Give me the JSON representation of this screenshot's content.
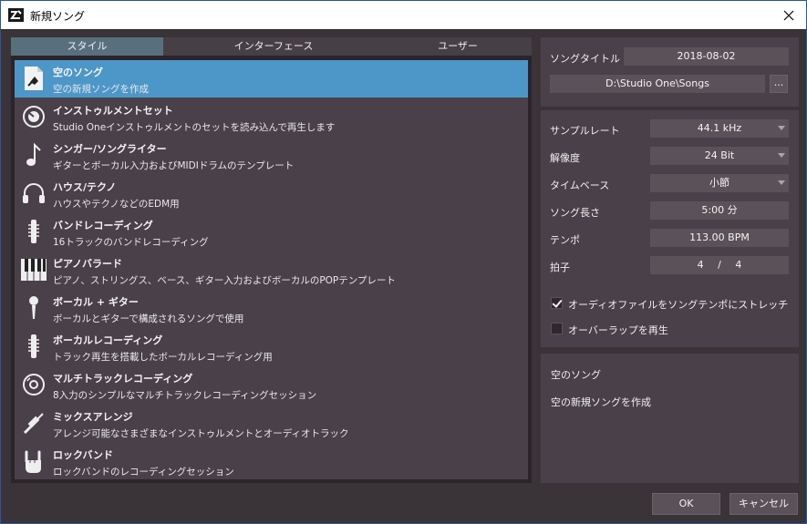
{
  "window": {
    "title": "新規ソング"
  },
  "tabs": [
    {
      "label": "スタイル",
      "active": true
    },
    {
      "label": "インターフェース",
      "active": false
    },
    {
      "label": "ユーザー",
      "active": false
    }
  ],
  "templates": [
    {
      "name": "空のソング",
      "desc": "空の新規ソングを作成",
      "icon": "blank-song-icon",
      "selected": true
    },
    {
      "name": "インストゥルメントセット",
      "desc": "Studio Oneインストゥルメントのセットを読み込んで再生します",
      "icon": "dial-icon",
      "selected": false
    },
    {
      "name": "シンガー/ソングライター",
      "desc": "ギターとボーカル入力およびMIDIドラムのテンプレート",
      "icon": "music-note-icon",
      "selected": false
    },
    {
      "name": "ハウス/テクノ",
      "desc": "ハウスやテクノなどのEDM用",
      "icon": "headphones-icon",
      "selected": false
    },
    {
      "name": "バンドレコーディング",
      "desc": "16トラックのバンドレコーディング",
      "icon": "mixer-icon",
      "selected": false
    },
    {
      "name": "ピアノバラード",
      "desc": "ピアノ、ストリングス、ベース、ギター入力およびボーカルのPOPテンプレート",
      "icon": "piano-keys-icon",
      "selected": false
    },
    {
      "name": "ボーカル + ギター",
      "desc": "ボーカルとギターで構成されるソングで使用",
      "icon": "microphone-icon",
      "selected": false
    },
    {
      "name": "ボーカルレコーディング",
      "desc": "トラック再生を搭載したボーカルレコーディング用",
      "icon": "mixer-icon",
      "selected": false
    },
    {
      "name": "マルチトラックレコーディング",
      "desc": "8入力のシンプルなマルチトラックレコーディングセッション",
      "icon": "disc-icon",
      "selected": false
    },
    {
      "name": "ミックスアレンジ",
      "desc": "アレンジ可能なさまざまなインストゥルメントとオーディオトラック",
      "icon": "cable-plug-icon",
      "selected": false
    },
    {
      "name": "ロックバンド",
      "desc": "ロックバンドのレコーディングセッション",
      "icon": "rock-hand-icon",
      "selected": false
    }
  ],
  "song": {
    "title_label": "ソングタイトル",
    "title_value": "2018-08-02",
    "path_value": "D:\\Studio One\\Songs",
    "browse_label": "..."
  },
  "settings": {
    "sample_rate_label": "サンプルレート",
    "sample_rate_value": "44.1 kHz",
    "resolution_label": "解像度",
    "resolution_value": "24 Bit",
    "timebase_label": "タイムベース",
    "timebase_value": "小節",
    "length_label": "ソング長さ",
    "length_value": "5:00 分",
    "tempo_label": "テンポ",
    "tempo_value": "113.00 BPM",
    "signature_label": "拍子",
    "signature_num": "4",
    "signature_sep": "/",
    "signature_den": "4",
    "stretch_label": "オーディオファイルをソングテンポにストレッチ",
    "stretch_checked": true,
    "overlap_label": "オーバーラップを再生",
    "overlap_checked": false
  },
  "info": {
    "title": "空のソング",
    "desc": "空の新規ソングを作成"
  },
  "buttons": {
    "ok": "OK",
    "cancel": "キャンセル"
  },
  "colors": {
    "selection": "#4d97c8",
    "active_tab": "#58707e",
    "panel": "#4a4049",
    "background": "#3a3338"
  }
}
